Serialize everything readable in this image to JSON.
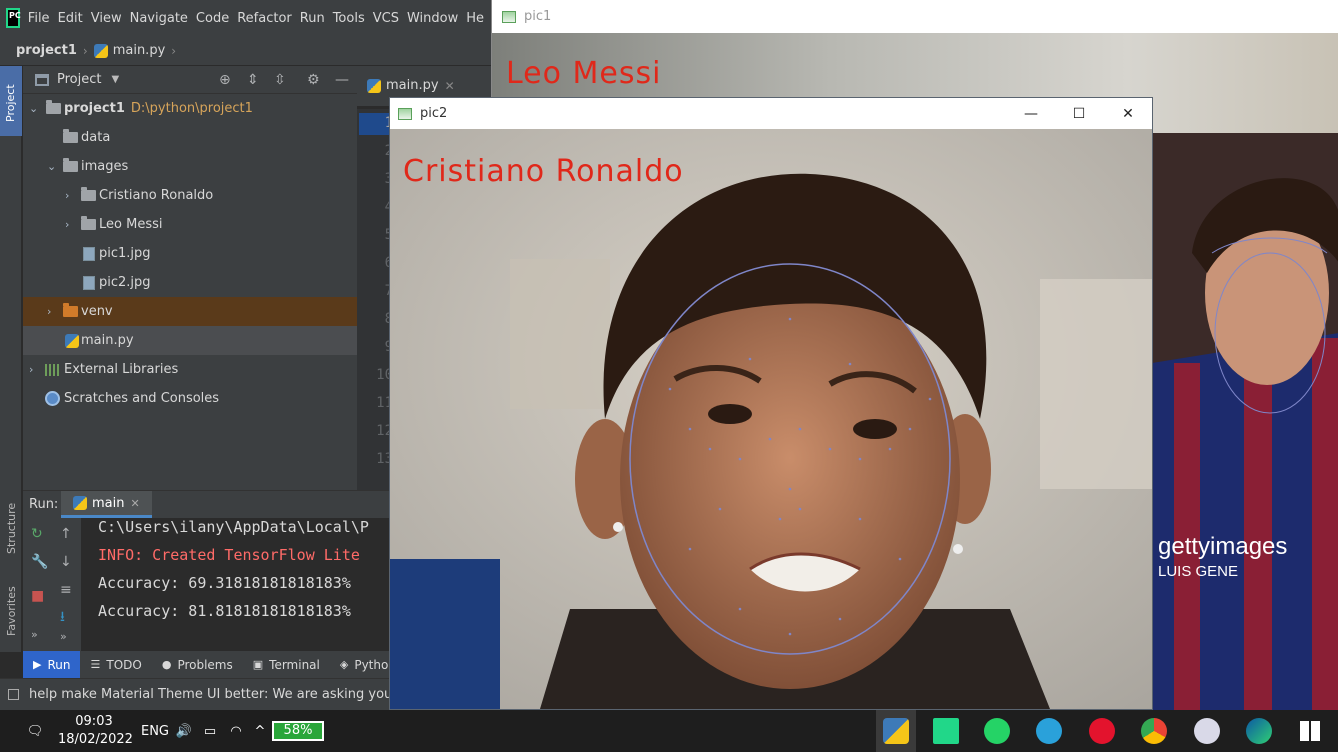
{
  "ide": {
    "menu": [
      "File",
      "Edit",
      "View",
      "Navigate",
      "Code",
      "Refactor",
      "Run",
      "Tools",
      "VCS",
      "Window",
      "He"
    ],
    "breadcrumb": {
      "project": "project1",
      "file": "main.py"
    },
    "left_strip": {
      "project": "Project",
      "structure": "Structure",
      "favorites": "Favorites"
    },
    "project_panel": {
      "title": "Project",
      "tree": [
        {
          "label": "project1",
          "path": "D:\\python\\project1"
        },
        {
          "label": "data"
        },
        {
          "label": "images"
        },
        {
          "label": "Cristiano Ronaldo"
        },
        {
          "label": "Leo Messi"
        },
        {
          "label": "pic1.jpg"
        },
        {
          "label": "pic2.jpg"
        },
        {
          "label": "venv"
        },
        {
          "label": "main.py"
        },
        {
          "label": "External Libraries"
        },
        {
          "label": "Scratches and Consoles"
        }
      ]
    },
    "editor": {
      "tab": "main.py",
      "line_numbers": [
        "1",
        "2",
        "3",
        "4",
        "5",
        "6",
        "7",
        "8",
        "9",
        "10",
        "11",
        "12",
        "13"
      ]
    },
    "run": {
      "label": "Run:",
      "tab": "main",
      "console": [
        "C:\\Users\\ilany\\AppData\\Local\\P",
        "INFO: Created TensorFlow Lite",
        "Accuracy: 69.31818181818183%",
        "Accuracy: 81.81818181818183%"
      ]
    },
    "bottom_tabs": [
      "Run",
      "TODO",
      "Problems",
      "Terminal",
      "Python P"
    ],
    "status_message": "help make Material Theme UI better: We are asking your permissi"
  },
  "pic1": {
    "title": "pic1",
    "label": "Leo Messi"
  },
  "pic2": {
    "title": "pic2",
    "label": "Cristiano Ronaldo"
  },
  "watermark": {
    "brand": "gettyimages",
    "credit": "LUIS GENE"
  },
  "taskbar": {
    "time": "09:03",
    "date": "18/02/2022",
    "language": "ENG",
    "battery": "58%"
  }
}
